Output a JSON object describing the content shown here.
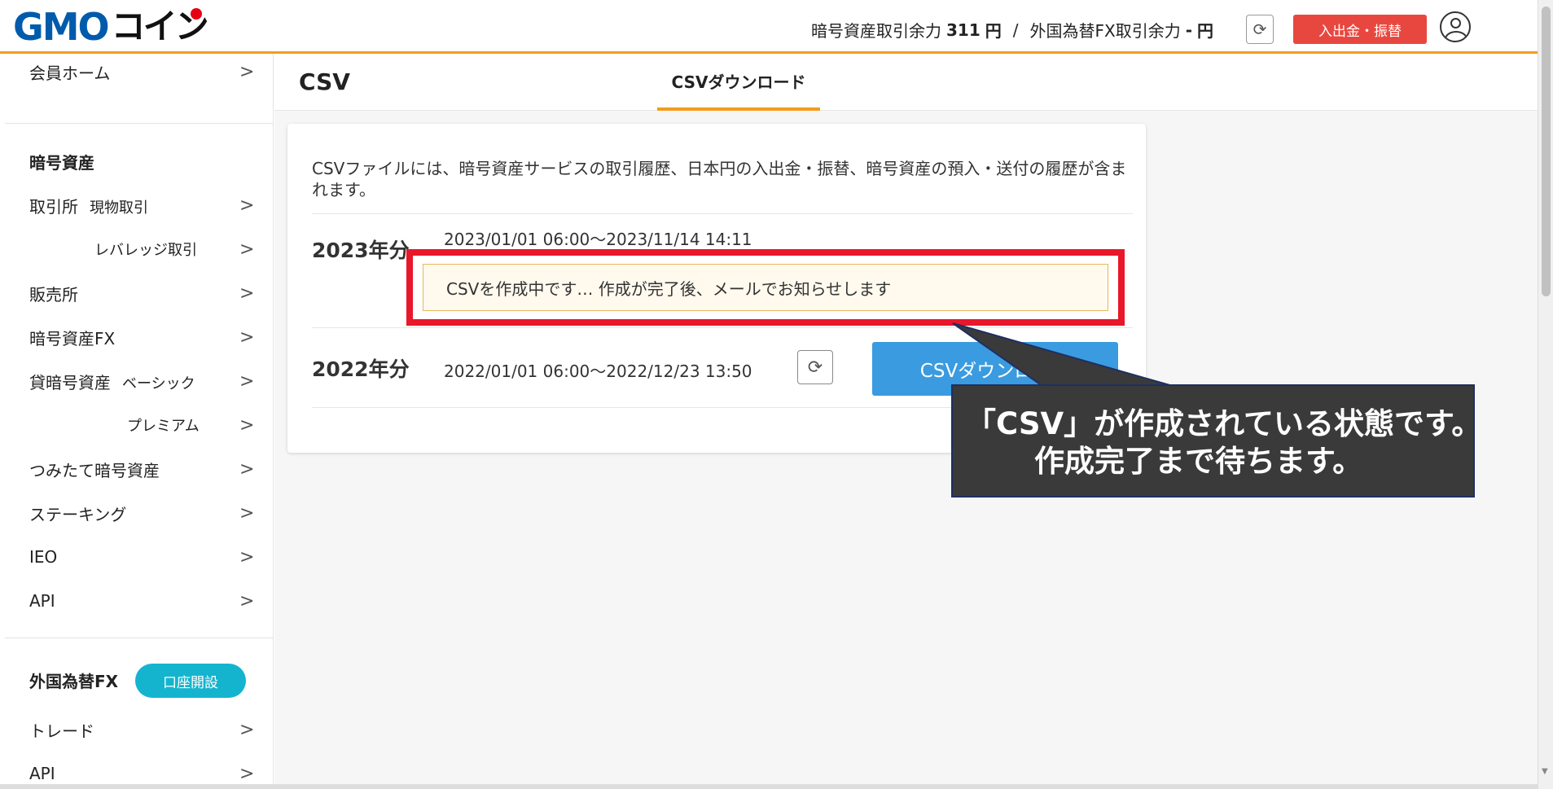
{
  "header": {
    "logo_gmo": "GMO",
    "logo_coin": "コイン",
    "crypto_balance_label": "暗号資産取引余力",
    "crypto_balance_value": "311",
    "crypto_balance_unit": "円",
    "separator": "/",
    "fx_balance_label": "外国為替FX取引余力",
    "fx_balance_value": "-",
    "fx_balance_unit": "円",
    "deposit_button": "入出金・振替",
    "accent_color": "#f39c1f"
  },
  "sidebar": {
    "member_home": "会員ホーム",
    "crypto_heading": "暗号資産",
    "exchange": "取引所",
    "exchange_spot": "現物取引",
    "exchange_leverage": "レバレッジ取引",
    "sales": "販売所",
    "crypto_fx": "暗号資産FX",
    "lending": "貸暗号資産",
    "lending_basic": "ベーシック",
    "lending_premium": "プレミアム",
    "tsumitate": "つみたて暗号資産",
    "staking": "ステーキング",
    "ieo": "IEO",
    "api": "API",
    "fx_heading": "外国為替FX",
    "open_account": "口座開設",
    "trade": "トレード",
    "fx_api": "API",
    "chevron": ">"
  },
  "main": {
    "title": "CSV",
    "tab_csv_download": "CSVダウンロード",
    "description": "CSVファイルには、暗号資産サービスの取引履歴、日本円の入出金・振替、暗号資産の預入・送付の履歴が含まれます。",
    "rows": [
      {
        "year": "2023年分",
        "period": "2023/01/01 06:00〜2023/11/14 14:11",
        "status": "CSVを作成中です… 作成が完了後、メールでお知らせします"
      },
      {
        "year": "2022年分",
        "period": "2022/01/01 06:00〜2022/12/23 13:50",
        "button": "CSVダウンロード"
      }
    ]
  },
  "callout": {
    "line1": "「CSV」が作成されている状態です。",
    "line2": "作成完了まで待ちます。"
  },
  "icons": {
    "refresh": "⟳"
  }
}
